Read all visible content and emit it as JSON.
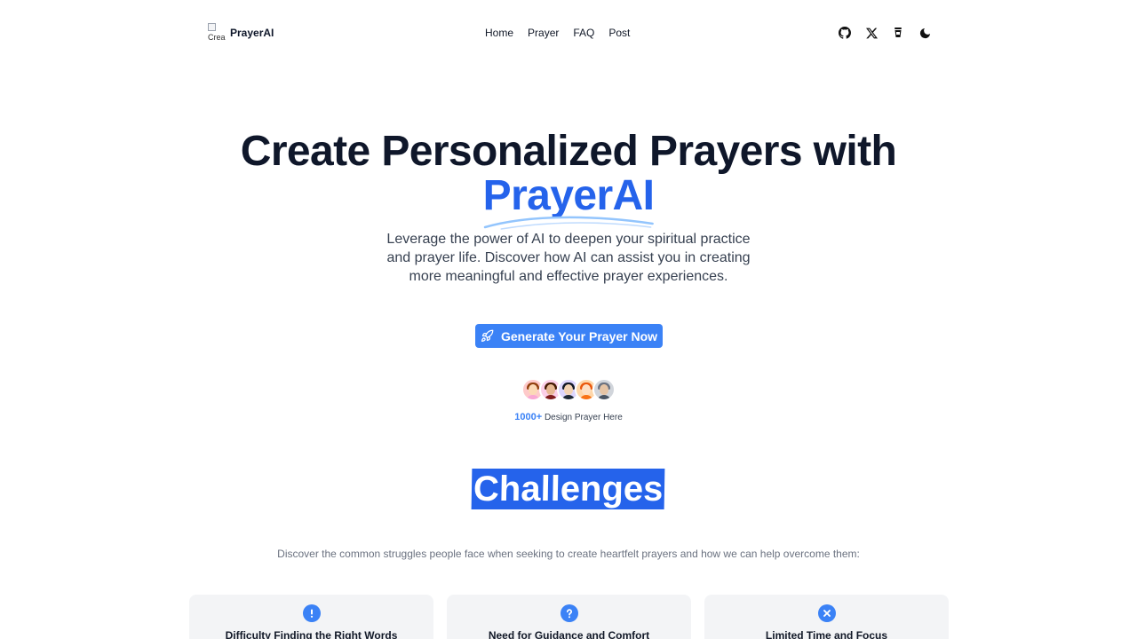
{
  "brand": {
    "name": "PrayerAI",
    "logo_alt": "Crea"
  },
  "nav": {
    "links": [
      "Home",
      "Prayer",
      "FAQ",
      "Post"
    ],
    "icons": [
      "github-icon",
      "x-icon",
      "coffee-icon",
      "moon-icon"
    ]
  },
  "hero": {
    "title": "Create Personalized Prayers with",
    "accent": "PrayerAI",
    "subtitle": "Leverage the power of AI to deepen your spiritual practice and prayer life. Discover how AI can assist you in creating more meaningful and effective prayer experiences.",
    "cta_label": "Generate Your Prayer Now",
    "social_count": "1000+",
    "social_text": "Design Prayer Here"
  },
  "challenges": {
    "title": "Challenges",
    "subtitle": "Discover the common struggles people face when seeking to create heartfelt prayers and how we can help overcome them:",
    "cards": [
      {
        "icon": "exclamation-icon",
        "title": "Difficulty Finding the Right Words"
      },
      {
        "icon": "question-icon",
        "title": "Need for Guidance and Comfort"
      },
      {
        "icon": "x-circle-icon",
        "title": "Limited Time and Focus"
      }
    ]
  },
  "colors": {
    "accent": "#2563eb",
    "button": "#3b82f6",
    "card_bg": "#f3f4f6"
  }
}
